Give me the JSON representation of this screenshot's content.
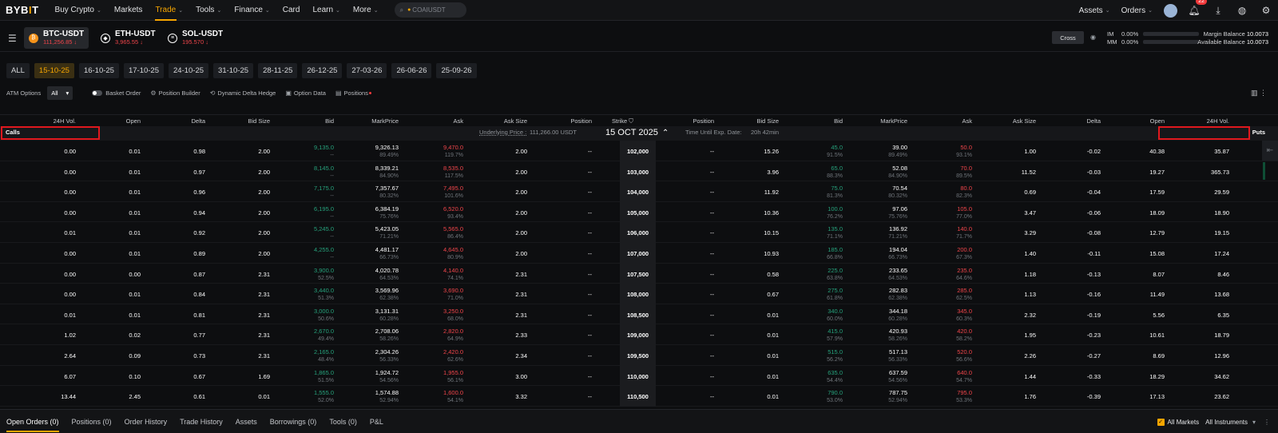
{
  "nav": {
    "logo_a": "BYB",
    "logo_b": "I",
    "logo_c": "T",
    "items": [
      {
        "label": "Buy Crypto",
        "chev": true
      },
      {
        "label": "Markets",
        "chev": false
      },
      {
        "label": "Trade",
        "chev": true,
        "active": true
      },
      {
        "label": "Tools",
        "chev": true
      },
      {
        "label": "Finance",
        "chev": true
      },
      {
        "label": "Card",
        "chev": false
      },
      {
        "label": "Learn",
        "chev": true
      },
      {
        "label": "More",
        "chev": true
      }
    ],
    "search_placeholder": "COAIUSDT",
    "assets": "Assets",
    "orders": "Orders",
    "notif_count": "22"
  },
  "tickers": [
    {
      "name": "BTC-USDT",
      "price": "111,256.85",
      "coin_color": "#f7931a",
      "coin_glyph": "₿"
    },
    {
      "name": "ETH-USDT",
      "price": "3,965.55",
      "coin_color": "#ffffff",
      "coin_glyph": "◆"
    },
    {
      "name": "SOL-USDT",
      "price": "195.570",
      "coin_color": "#ffffff",
      "coin_glyph": "≡"
    }
  ],
  "margin": {
    "cross": "Cross",
    "im_label": "IM",
    "im_value": "0.00%",
    "mm_label": "MM",
    "mm_value": "0.00%",
    "margin_balance_label": "Margin Balance",
    "margin_balance": "10.0073",
    "available_balance_label": "Available Balance",
    "available_balance": "10.0073"
  },
  "date_tabs": [
    "ALL",
    "15-10-25",
    "16-10-25",
    "17-10-25",
    "24-10-25",
    "31-10-25",
    "28-11-25",
    "26-12-25",
    "27-03-26",
    "26-06-26",
    "25-09-26"
  ],
  "active_date": "15-10-25",
  "tools": {
    "atm_label": "ATM Options",
    "atm_value": "All",
    "basket": "Basket Order",
    "position_builder": "Position Builder",
    "delta_hedge": "Dynamic Delta Hedge",
    "option_data": "Option Data",
    "positions": "Positions"
  },
  "table": {
    "call_headers": [
      "24H Vol.",
      "Open",
      "Delta",
      "Bid Size",
      "Bid",
      "MarkPrice",
      "Ask",
      "Ask Size",
      "Position"
    ],
    "strike_header": "Strike",
    "put_headers": [
      "Position",
      "Bid Size",
      "Bid",
      "MarkPrice",
      "Ask",
      "Ask Size",
      "Delta",
      "Open",
      "24H Vol."
    ],
    "calls_label": "Calls",
    "puts_label": "Puts",
    "underlying_label": "Underlying Price :",
    "underlying_value": "111,266.00 USDT",
    "expiry_date": "15 OCT 2025",
    "time_label": "Time Until Exp. Date:",
    "time_value": "20h 42min"
  },
  "rows": [
    {
      "strike": "102,000",
      "c": [
        "0.00",
        "0.01",
        "0.98",
        "2.00",
        "9,135.0",
        "--",
        "9,326.13",
        "89.49%",
        "9,470.0",
        "119.7%",
        "2.00",
        "--"
      ],
      "p": [
        "--",
        "15.26",
        "45.0",
        "91.5%",
        "39.00",
        "89.49%",
        "50.0",
        "93.1%",
        "1.00",
        "-0.02",
        "40.38",
        "35.87"
      ]
    },
    {
      "strike": "103,000",
      "c": [
        "0.00",
        "0.01",
        "0.97",
        "2.00",
        "8,145.0",
        "--",
        "8,339.21",
        "84.90%",
        "8,535.0",
        "117.5%",
        "2.00",
        "--"
      ],
      "p": [
        "--",
        "3.96",
        "65.0",
        "88.3%",
        "52.08",
        "84.90%",
        "70.0",
        "89.5%",
        "11.52",
        "-0.03",
        "19.27",
        "365.73"
      ]
    },
    {
      "strike": "104,000",
      "c": [
        "0.00",
        "0.01",
        "0.96",
        "2.00",
        "7,175.0",
        "--",
        "7,357.67",
        "80.32%",
        "7,495.0",
        "101.6%",
        "2.00",
        "--"
      ],
      "p": [
        "--",
        "11.92",
        "75.0",
        "81.3%",
        "70.54",
        "80.32%",
        "80.0",
        "82.3%",
        "0.69",
        "-0.04",
        "17.59",
        "29.59"
      ]
    },
    {
      "strike": "105,000",
      "c": [
        "0.00",
        "0.01",
        "0.94",
        "2.00",
        "6,195.0",
        "--",
        "6,384.19",
        "75.76%",
        "6,520.0",
        "93.4%",
        "2.00",
        "--"
      ],
      "p": [
        "--",
        "10.36",
        "100.0",
        "76.2%",
        "97.06",
        "75.76%",
        "105.0",
        "77.0%",
        "3.47",
        "-0.06",
        "18.09",
        "18.90"
      ]
    },
    {
      "strike": "106,000",
      "c": [
        "0.01",
        "0.01",
        "0.92",
        "2.00",
        "5,245.0",
        "--",
        "5,423.05",
        "71.21%",
        "5,565.0",
        "86.4%",
        "2.00",
        "--"
      ],
      "p": [
        "--",
        "10.15",
        "135.0",
        "71.1%",
        "136.92",
        "71.21%",
        "140.0",
        "71.7%",
        "3.29",
        "-0.08",
        "12.79",
        "19.15"
      ]
    },
    {
      "strike": "107,000",
      "c": [
        "0.00",
        "0.01",
        "0.89",
        "2.00",
        "4,255.0",
        "--",
        "4,481.17",
        "66.73%",
        "4,645.0",
        "80.9%",
        "2.00",
        "--"
      ],
      "p": [
        "--",
        "10.93",
        "185.0",
        "66.8%",
        "194.04",
        "66.73%",
        "200.0",
        "67.3%",
        "1.40",
        "-0.11",
        "15.08",
        "17.24"
      ]
    },
    {
      "strike": "107,500",
      "c": [
        "0.00",
        "0.00",
        "0.87",
        "2.31",
        "3,900.0",
        "52.5%",
        "4,020.78",
        "64.53%",
        "4,140.0",
        "74.1%",
        "2.31",
        "--"
      ],
      "p": [
        "--",
        "0.58",
        "225.0",
        "63.8%",
        "233.65",
        "64.53%",
        "235.0",
        "64.6%",
        "1.18",
        "-0.13",
        "8.07",
        "8.46"
      ]
    },
    {
      "strike": "108,000",
      "c": [
        "0.00",
        "0.01",
        "0.84",
        "2.31",
        "3,440.0",
        "51.3%",
        "3,569.96",
        "62.38%",
        "3,690.0",
        "71.0%",
        "2.31",
        "--"
      ],
      "p": [
        "--",
        "0.67",
        "275.0",
        "61.8%",
        "282.83",
        "62.38%",
        "285.0",
        "62.5%",
        "1.13",
        "-0.16",
        "11.49",
        "13.68"
      ]
    },
    {
      "strike": "108,500",
      "c": [
        "0.01",
        "0.01",
        "0.81",
        "2.31",
        "3,000.0",
        "50.6%",
        "3,131.31",
        "60.28%",
        "3,250.0",
        "68.0%",
        "2.31",
        "--"
      ],
      "p": [
        "--",
        "0.01",
        "340.0",
        "60.0%",
        "344.18",
        "60.28%",
        "345.0",
        "60.3%",
        "2.32",
        "-0.19",
        "5.56",
        "6.35"
      ]
    },
    {
      "strike": "109,000",
      "c": [
        "1.02",
        "0.02",
        "0.77",
        "2.31",
        "2,670.0",
        "49.4%",
        "2,708.06",
        "58.26%",
        "2,820.0",
        "64.9%",
        "2.33",
        "--"
      ],
      "p": [
        "--",
        "0.01",
        "415.0",
        "57.9%",
        "420.93",
        "58.26%",
        "420.0",
        "58.2%",
        "1.95",
        "-0.23",
        "10.61",
        "18.79"
      ]
    },
    {
      "strike": "109,500",
      "c": [
        "2.64",
        "0.09",
        "0.73",
        "2.31",
        "2,165.0",
        "48.4%",
        "2,304.26",
        "56.33%",
        "2,420.0",
        "62.6%",
        "2.34",
        "--"
      ],
      "p": [
        "--",
        "0.01",
        "515.0",
        "56.2%",
        "517.13",
        "56.33%",
        "520.0",
        "56.6%",
        "2.26",
        "-0.27",
        "8.69",
        "12.96"
      ]
    },
    {
      "strike": "110,000",
      "c": [
        "6.07",
        "0.10",
        "0.67",
        "1.69",
        "1,865.0",
        "51.5%",
        "1,924.72",
        "54.56%",
        "1,955.0",
        "56.1%",
        "3.00",
        "--"
      ],
      "p": [
        "--",
        "0.01",
        "635.0",
        "54.4%",
        "637.59",
        "54.56%",
        "640.0",
        "54.7%",
        "1.44",
        "-0.33",
        "18.29",
        "34.62"
      ]
    },
    {
      "strike": "110,500",
      "c": [
        "13.44",
        "2.45",
        "0.61",
        "0.01",
        "1,555.0",
        "52.0%",
        "1,574.88",
        "52.94%",
        "1,600.0",
        "54.1%",
        "3.32",
        "--"
      ],
      "p": [
        "--",
        "0.01",
        "790.0",
        "53.0%",
        "787.75",
        "52.94%",
        "795.0",
        "53.3%",
        "1.76",
        "-0.39",
        "17.13",
        "23.62"
      ]
    }
  ],
  "bottom": {
    "tabs": [
      "Open Orders (0)",
      "Positions (0)",
      "Order History",
      "Trade History",
      "Assets",
      "Borrowings (0)",
      "Tools (0)",
      "P&L"
    ],
    "all_markets": "All Markets",
    "all_instruments": "All Instruments"
  }
}
